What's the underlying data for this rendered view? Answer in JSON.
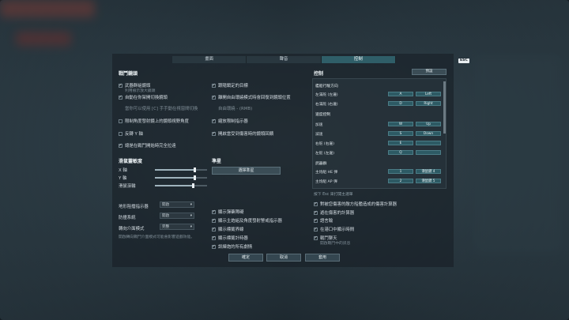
{
  "tabs": [
    "畫面",
    "聲音",
    "控制"
  ],
  "esc_badge": "ESC",
  "combat": {
    "title": "戰鬥鏡頭",
    "left_options": [
      {
        "label": "武器群組鏡頭",
        "checked": true,
        "sub": "利用檢示放大鏡頭"
      },
      {
        "label": "自動在你架開切換鏡頭",
        "checked": true
      },
      {
        "label": "當你可以使用 [C] 手手動在視窗間切換",
        "checked": false,
        "disabled": true
      },
      {
        "label": "限制角度發射鏡上的鏡頭視野角度",
        "checked": false
      },
      {
        "label": "反轉 Y 軸",
        "checked": false
      },
      {
        "label": "總是在戰鬥開始時完全拉遠",
        "checked": true
      }
    ],
    "right_options": [
      {
        "label": "跟隨鎖定的目標",
        "checked": true
      },
      {
        "label": "離開自由環繞模式時會回復到鏡頭位置",
        "checked": true
      },
      {
        "label": "自由環繞 - (RMB)",
        "checked": false,
        "disabled": true
      },
      {
        "label": "縮放限制指示器",
        "checked": true
      },
      {
        "label": "開啟當受到傷害時的鏡頭回饋",
        "checked": true
      }
    ]
  },
  "sensitivity": {
    "title": "滑鼠靈敏度",
    "sliders": [
      {
        "label": "X 軸",
        "value": 0.75
      },
      {
        "label": "Y 軸",
        "value": 0.75
      },
      {
        "label": "滑鼠滾輪",
        "value": 0.72
      }
    ]
  },
  "crosshair": {
    "title": "準星",
    "button": "選擇準星"
  },
  "dropdowns": [
    {
      "label": "地形阻擋指示器",
      "value": "開啟"
    },
    {
      "label": "防撞系統",
      "value": "開啟"
    },
    {
      "label": "轉向介面模式",
      "value": "完整"
    }
  ],
  "dropdown_note": "開啟轉向戰鬥介面模式可能會影響遊戲效能。",
  "display_options": [
    {
      "label": "顯示彈藥障礙",
      "checked": true
    },
    {
      "label": "顯示主炮組及角度發射警戒指示器",
      "checked": true
    },
    {
      "label": "顯示標籤界線",
      "checked": true
    },
    {
      "label": "顯示標籤計時器",
      "checked": true
    },
    {
      "label": "訓練炮的所有劇情",
      "checked": true
    }
  ],
  "controls": {
    "title": "控制",
    "preset": "預設",
    "groups": [
      {
        "name": "艦船行駛方向",
        "rows": [
          {
            "label": "左滿舵 (左邊)",
            "key1": "A",
            "key2": "Left"
          },
          {
            "label": "右滿舵 (右邊)",
            "key1": "D",
            "key2": "Right"
          }
        ]
      },
      {
        "name": "速度控制",
        "rows": [
          {
            "label": "加速",
            "key1": "W",
            "key2": "Up"
          },
          {
            "label": "減速",
            "key1": "S",
            "key2": "Down"
          },
          {
            "label": "右舵 (右邊)",
            "key1": "E",
            "key2": ""
          },
          {
            "label": "左舵 (左邊)",
            "key1": "Q",
            "key2": ""
          }
        ]
      },
      {
        "name": "武器群",
        "rows": [
          {
            "label": "主炮組 HE 彈",
            "key1": "1",
            "key2": "滑鼠鍵 4"
          },
          {
            "label": "主炮組 AP 彈",
            "key1": "2",
            "key2": "滑鼠鍵 5"
          }
        ]
      }
    ],
    "hint": "按下 Esc 來打開主選單"
  },
  "misc_options": [
    {
      "label": "對被您傷害的敵方船艦造成的傷害計算器",
      "checked": true
    },
    {
      "label": "遊在傷害的計算器",
      "checked": true
    },
    {
      "label": "語言輸",
      "checked": true
    },
    {
      "label": "在港口中顯示時間",
      "checked": true
    },
    {
      "label": "戰鬥聊天",
      "checked": true,
      "sub": "開啟戰鬥中的訊息"
    }
  ],
  "footer": {
    "confirm": "確定",
    "cancel": "取消",
    "apply": "套用"
  }
}
